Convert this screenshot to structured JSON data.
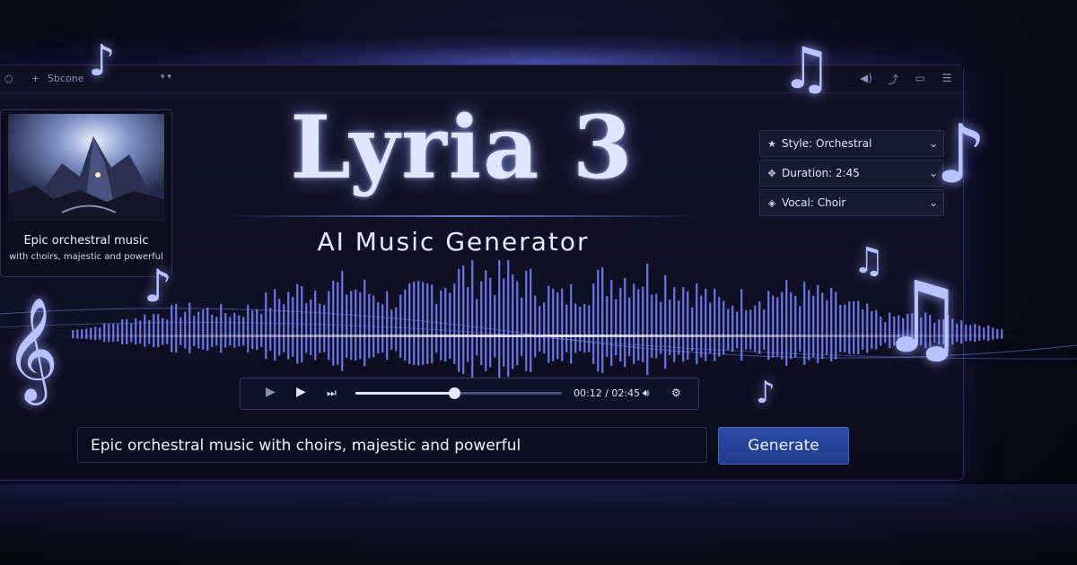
{
  "titlebar": {
    "search_label": "Sbcone",
    "menu_caret": "▾ ▾",
    "right_icons": [
      "volume-icon",
      "share-icon",
      "screen-icon",
      "menu-icon"
    ]
  },
  "thumbnail": {
    "caption_line1": "Epic orchestral music",
    "caption_line2": "with choirs, majestic and powerful"
  },
  "header": {
    "title": "Lyria 3",
    "subtitle": "AI Music Generator"
  },
  "settings": [
    {
      "label": "Style: Orchestral",
      "icon": "star-icon"
    },
    {
      "label": "Duration: 2:45",
      "icon": "arrows-icon"
    },
    {
      "label": "Vocal: Choir",
      "icon": "diamond-icon"
    }
  ],
  "player": {
    "time": "00:12 / 02:45",
    "progress": 0.48
  },
  "prompt": {
    "value": "Epic orchestral music with choirs, majestic and powerful"
  },
  "generate_label": "Generate",
  "colors": {
    "accent": "#2c4aa8",
    "wave_start": "#3a7bff",
    "wave_end": "#b07cff"
  }
}
